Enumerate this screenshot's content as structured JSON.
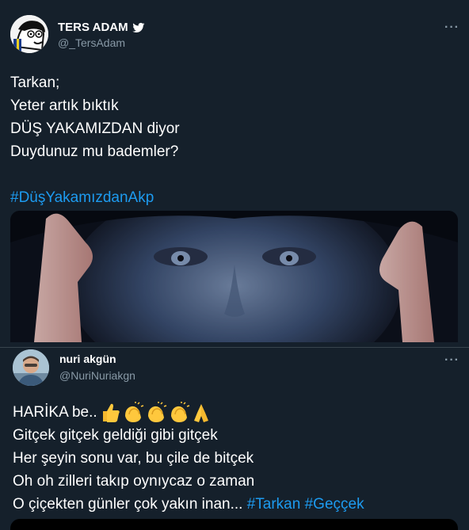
{
  "tweet1": {
    "author_name": "TERS ADAM",
    "author_handle": "@_TersAdam",
    "more_label": "···",
    "icons": {
      "verified": "verified-badge-icon",
      "more": "more-options-icon"
    },
    "lines": [
      "Tarkan;",
      "Yeter artık bıktık",
      "DÜŞ YAKAMIZDAN diyor",
      "Duydunuz mu bademler?"
    ],
    "hashtag": "#DüşYakamızdanAkp"
  },
  "tweet2": {
    "author_name": "nuri akgün",
    "author_handle": "@NuriNuriakgn",
    "more_label": "···",
    "line1_text": "HARİKA be..",
    "line1_emoji": [
      "thumbs-up",
      "clapping-hands",
      "clapping-hands",
      "clapping-hands",
      "folded-hands"
    ],
    "lines": [
      "Gitçek gitçek geldiği gibi gitçek",
      "Her şeyin sonu var, bu çile de bitçek",
      "Oh oh zilleri takıp oynıycaz o zaman"
    ],
    "last_line_text": "O çiçekten günler çok yakın inan... ",
    "hashtags": [
      "#Tarkan",
      "#Geççek"
    ]
  },
  "colors": {
    "background": "#15202b",
    "text": "#ffffff",
    "secondary": "#8899a6",
    "link": "#1d9bf0",
    "divider": "#38444d",
    "verified": "#ffffff"
  }
}
